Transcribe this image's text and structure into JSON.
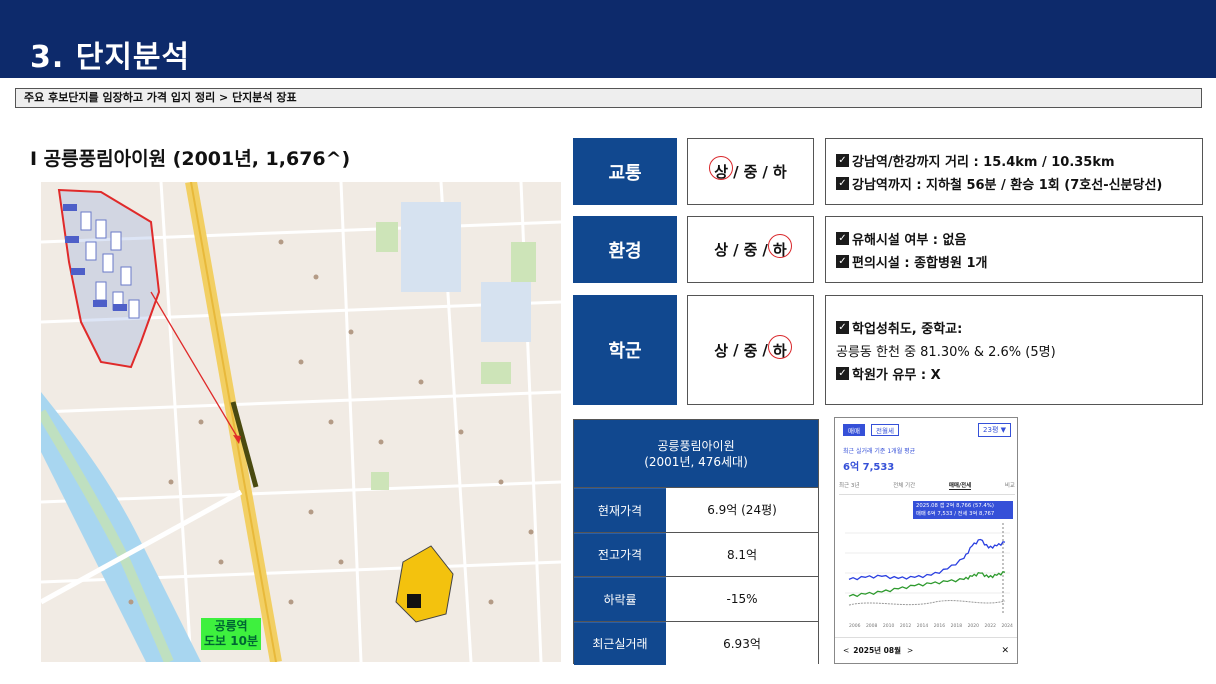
{
  "header": {
    "title": "3. 단지분석"
  },
  "breadcrumb": "주요 후보단지를 임장하고 가격 입지 정리 > 단지분석 장표",
  "complex": {
    "title": "I 공릉풍림아이원 (2001년, 1,676^)"
  },
  "map": {
    "station_label_line1": "공릉역",
    "station_label_line2": "도보 10분"
  },
  "categories": [
    {
      "name": "교통",
      "selected": "상",
      "grades": [
        "상",
        "중",
        "하"
      ],
      "details": [
        {
          "text": "강남역/한강까지 거리 : 15.4km / 10.35km",
          "check": true
        },
        {
          "text": "강남역까지 : 지하철 56분 / 환승 1회 (7호선-신분당선)",
          "check": true
        }
      ]
    },
    {
      "name": "환경",
      "selected": "하",
      "grades": [
        "상",
        "중",
        "하"
      ],
      "details": [
        {
          "text": "유해시설 여부 : 없음",
          "check": true
        },
        {
          "text": "편의시설 : 종합병원 1개",
          "check": true
        }
      ]
    },
    {
      "name": "학군",
      "selected": "하",
      "grades": [
        "상",
        "중",
        "하"
      ],
      "details": [
        {
          "text": "학업성취도, 중학교:",
          "check": true
        },
        {
          "text": "공릉동 한천 중 81.30% & 2.6% (5명)",
          "check": false
        },
        {
          "text": "학원가 유무 : X",
          "check": true
        }
      ]
    }
  ],
  "price_table": {
    "head_line1": "공릉풍림아이원",
    "head_line2": "(2001년, 476세대)",
    "rows": [
      {
        "label": "현재가격",
        "value": "6.9억 (24평)"
      },
      {
        "label": "전고가격",
        "value": "8.1억"
      },
      {
        "label": "하락률",
        "value": "-15%"
      },
      {
        "label": "최근실거래",
        "value": "6.93억"
      }
    ]
  },
  "price_chart": {
    "tab_active": "매매",
    "tab_inactive": "전월세",
    "size_select": "23평 ▼",
    "caption": "최근 실거래 기준 1개월 평균",
    "price": "6억 7,533",
    "periods": [
      "최근 3년",
      "전체 기간",
      "매매/전세",
      "비교"
    ],
    "active_period": "매매/전세",
    "tooltip_line1": "2025.08 갭 2억 8,766 (57.4%)",
    "tooltip_line2": "매매 6억 7,533 / 전세 3억 8,767",
    "x_axis": [
      "2006",
      "2008",
      "2010",
      "2012",
      "2014",
      "2016",
      "2018",
      "2020",
      "2022",
      "2024"
    ],
    "month": "2025년 08월",
    "prev": "<",
    "next": ">",
    "close": "✕",
    "colors": {
      "sale": "#2a3fe0",
      "jeonse": "#2e9a2e",
      "ratio": "#999999"
    },
    "chart_data": {
      "type": "line",
      "x": [
        2006,
        2008,
        2010,
        2012,
        2014,
        2016,
        2018,
        2020,
        2021,
        2022,
        2023,
        2024,
        2025
      ],
      "series": [
        {
          "values": [
            3.2,
            3.4,
            3.5,
            3.3,
            3.4,
            3.6,
            4.2,
            5.2,
            6.4,
            7.0,
            6.2,
            6.4,
            6.75
          ]
        },
        {
          "values": [
            1.6,
            1.8,
            2.0,
            2.3,
            2.6,
            2.8,
            3.0,
            3.2,
            3.5,
            3.8,
            3.4,
            3.6,
            3.88
          ]
        }
      ]
    }
  }
}
